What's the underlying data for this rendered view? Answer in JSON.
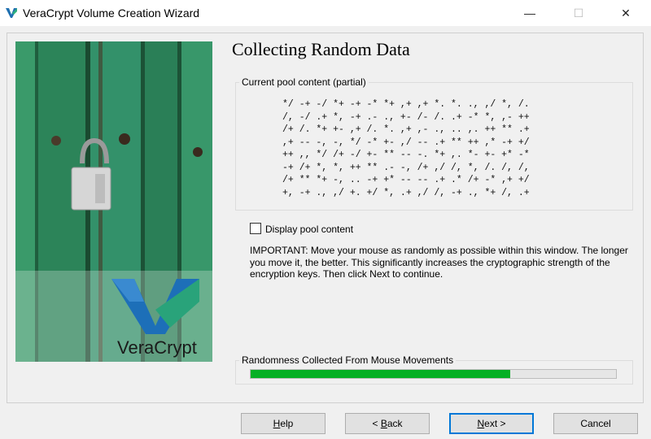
{
  "window": {
    "title": "VeraCrypt Volume Creation Wizard",
    "minimize_glyph": "—",
    "maximize_glyph": "☐",
    "close_glyph": "✕"
  },
  "banner": {
    "logo_text": "VeraCrypt"
  },
  "page": {
    "heading": "Collecting Random Data",
    "pool_group_label": "Current pool content (partial)",
    "pool_lines": [
      "*/ -+ -/ *+ -+ -* *+ ,+ ,+ *. *. ., ,/ *, /.",
      "/, -/ .+ *, -+ .- ., +- /- /. .+ -* *, ,- ++",
      "/+ /. *+ +- ,+ /. *. ,+ ,- ., .. ,. ++ ** .+",
      ",+ -- -, -, */ -* +- ,/ -- .+ ** ++ ,* -+ +/",
      "++ ,, */ /+ -/ +- ** -- -. *+ ,. *- +- +* -*",
      "-+ /+ *, *, ++ ** .- -, /+ ,/ /, *, /. /, /,",
      "/+ ** *+ -, .. -+ +* -- -- .+ .* /+ -* ,+ +/",
      "+, -+ ., ,/ +. +/ *, .+ ,/ /, -+ ., *+ /, .+"
    ],
    "display_pool_label": "Display pool content",
    "display_pool_checked": false,
    "important_text": "IMPORTANT: Move your mouse as randomly as possible within this window. The longer you move it, the better. This significantly increases the cryptographic strength of the encryption keys. Then click Next to continue.",
    "randomness_group_label": "Randomness Collected From Mouse Movements",
    "randomness_progress": 0.71
  },
  "buttons": {
    "help": {
      "label": "Help",
      "mnemonic": "H",
      "rest": "elp"
    },
    "back": {
      "prefix": "< ",
      "mnemonic": "B",
      "rest": "ack"
    },
    "next": {
      "mnemonic": "N",
      "rest": "ext >"
    },
    "cancel": {
      "label": "Cancel"
    }
  },
  "colors": {
    "progress": "#06b025",
    "banner_green": "#2f8a5f",
    "default_button_border": "#0078d7"
  }
}
